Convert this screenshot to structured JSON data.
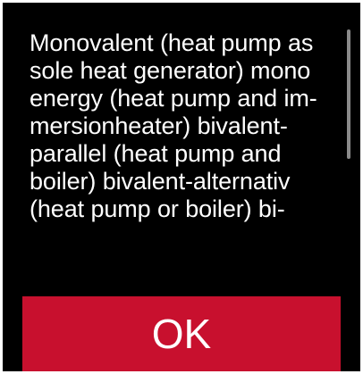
{
  "dialog": {
    "message": "Monovalent (heat pump as sole heat generator) mono energy (heat pump and im-mersionheater) bivalent-parallel (heat pump and boiler) bivalent-alternativ (heat pump or boiler) bi-",
    "ok_label": "OK"
  },
  "colors": {
    "background": "#000000",
    "text": "#ffffff",
    "accent": "#c8102e",
    "scrollbar": "#8a8a8a"
  }
}
